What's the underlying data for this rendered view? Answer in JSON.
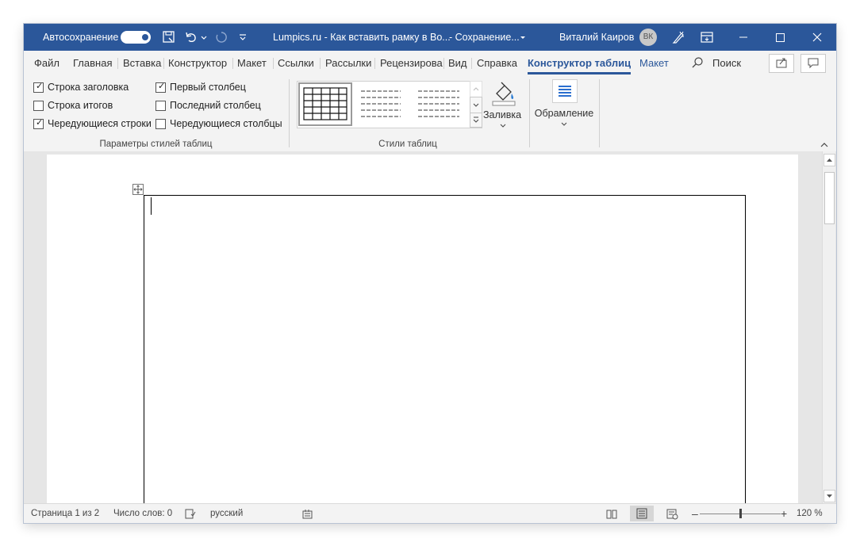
{
  "titlebar": {
    "autosave_label": "Автосохранение",
    "doc_title": "Lumpics.ru - Как вставить рамку в Во...",
    "save_status": "-  Сохранение...",
    "user_name": "Виталий Каиров",
    "avatar_initials": "ВК"
  },
  "tabs": [
    {
      "label": "Файл"
    },
    {
      "label": "Главная"
    },
    {
      "label": "Вставка"
    },
    {
      "label": "Конструктор"
    },
    {
      "label": "Макет"
    },
    {
      "label": "Ссылки"
    },
    {
      "label": "Рассылки"
    },
    {
      "label": "Рецензирова"
    },
    {
      "label": "Вид"
    },
    {
      "label": "Справка"
    },
    {
      "label": "Конструктор таблиц"
    },
    {
      "label": "Макет"
    }
  ],
  "search_label": "Поиск",
  "ribbon": {
    "style_options": {
      "header_row": {
        "label": "Строка заголовка",
        "checked": true
      },
      "total_row": {
        "label": "Строка итогов",
        "checked": false
      },
      "banded_rows": {
        "label": "Чередующиеся строки",
        "checked": true
      },
      "first_column": {
        "label": "Первый столбец",
        "checked": true
      },
      "last_column": {
        "label": "Последний столбец",
        "checked": false
      },
      "banded_columns": {
        "label": "Чередующиеся столбцы",
        "checked": false
      },
      "group_label": "Параметры стилей таблиц"
    },
    "table_styles": {
      "group_label": "Стили таблиц",
      "shading_label": "Заливка"
    },
    "borders": {
      "label": "Обрамление"
    }
  },
  "statusbar": {
    "page": "Страница 1 из 2",
    "words": "Число слов: 0",
    "language": "русский",
    "zoom": "120 %"
  },
  "colors": {
    "accent": "#2b579a"
  }
}
